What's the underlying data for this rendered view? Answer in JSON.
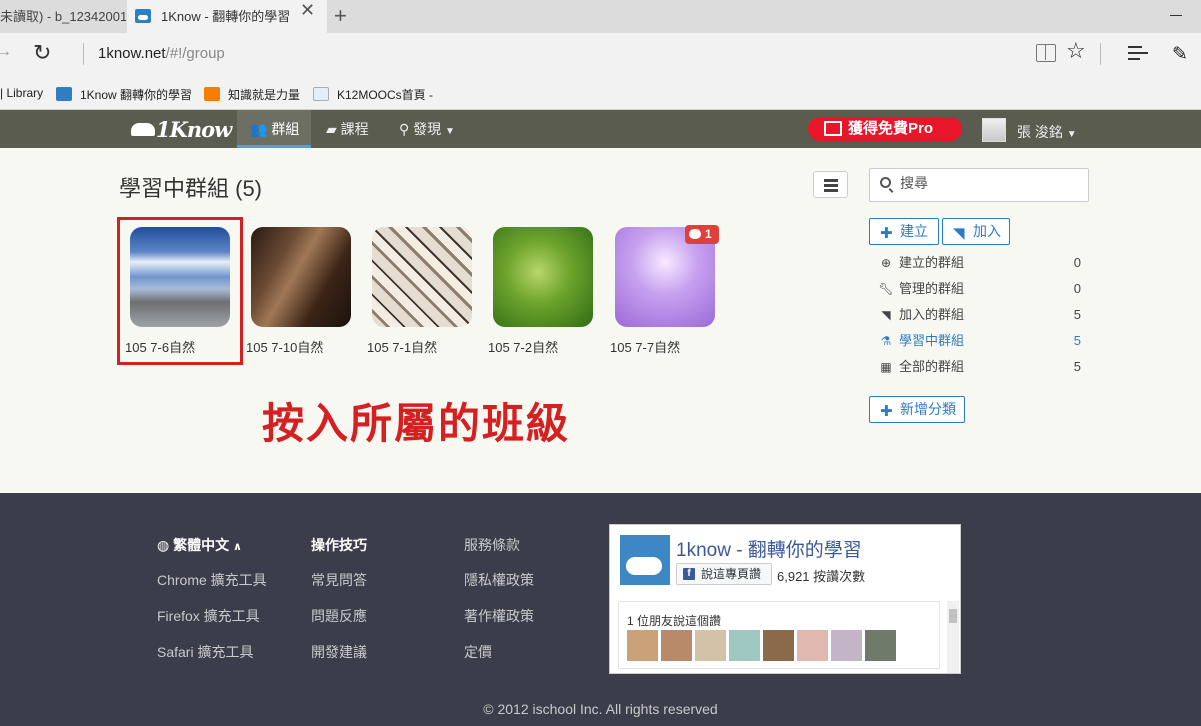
{
  "browser": {
    "inactive_tab": "未讀取) - b_12342001",
    "active_tab": "1Know - 翻轉你的學習",
    "close_tab": "✕",
    "new_tab": "+",
    "url_host": "1know.net",
    "url_path": "/#!/group",
    "favorites": [
      {
        "label": "| Library"
      },
      {
        "label": "1Know 翻轉你的學習"
      },
      {
        "label": "知識就是力量"
      },
      {
        "label": "K12MOOCs首頁 -"
      }
    ]
  },
  "nav": {
    "logo": "1Know",
    "groups": "群組",
    "courses": "課程",
    "discover": "發現",
    "promo": "獲得免費Pro",
    "user": "張 浚銘"
  },
  "main": {
    "title": "學習中群組 (5)",
    "search_placeholder": "搜尋",
    "groups": [
      {
        "label": "105 7-6自然"
      },
      {
        "label": "105 7-10自然"
      },
      {
        "label": "105 7-1自然"
      },
      {
        "label": "105 7-2自然"
      },
      {
        "label": "105 7-7自然",
        "badge": "1"
      }
    ],
    "annotation": "按入所屬的班級"
  },
  "sidebar": {
    "create": "建立",
    "join": "加入",
    "items": [
      {
        "label": "建立的群組",
        "count": "0",
        "icon": "plus-circle-icon"
      },
      {
        "label": "管理的群組",
        "count": "0",
        "icon": "wrench-icon"
      },
      {
        "label": "加入的群組",
        "count": "5",
        "icon": "rss-icon"
      },
      {
        "label": "學習中群組",
        "count": "5",
        "icon": "flask-icon"
      },
      {
        "label": "全部的群組",
        "count": "5",
        "icon": "grid-icon"
      }
    ],
    "add_category": "新增分類"
  },
  "footer": {
    "language": "繁體中文",
    "col1": [
      "Chrome 擴充工具",
      "Firefox 擴充工具",
      "Safari 擴充工具"
    ],
    "col2_title": "操作技巧",
    "col2": [
      "常見問答",
      "問題反應",
      "開發建議"
    ],
    "col3": [
      "服務條款",
      "隱私權政策",
      "著作權政策",
      "定價"
    ],
    "fb": {
      "title": "1know - 翻轉你的學習",
      "like_button": "說這專頁讚",
      "likes": "6,921 按讚次數",
      "friends": "1 位朋友說這個讚"
    },
    "copyright": "© 2012 ischool Inc. All rights reserved"
  },
  "colors": {
    "accent": "#2a7cc7",
    "nav_bg": "#5b5c50",
    "footer_bg": "#3b3e4a",
    "promo": "#e8162a",
    "annotation": "#d42020"
  }
}
